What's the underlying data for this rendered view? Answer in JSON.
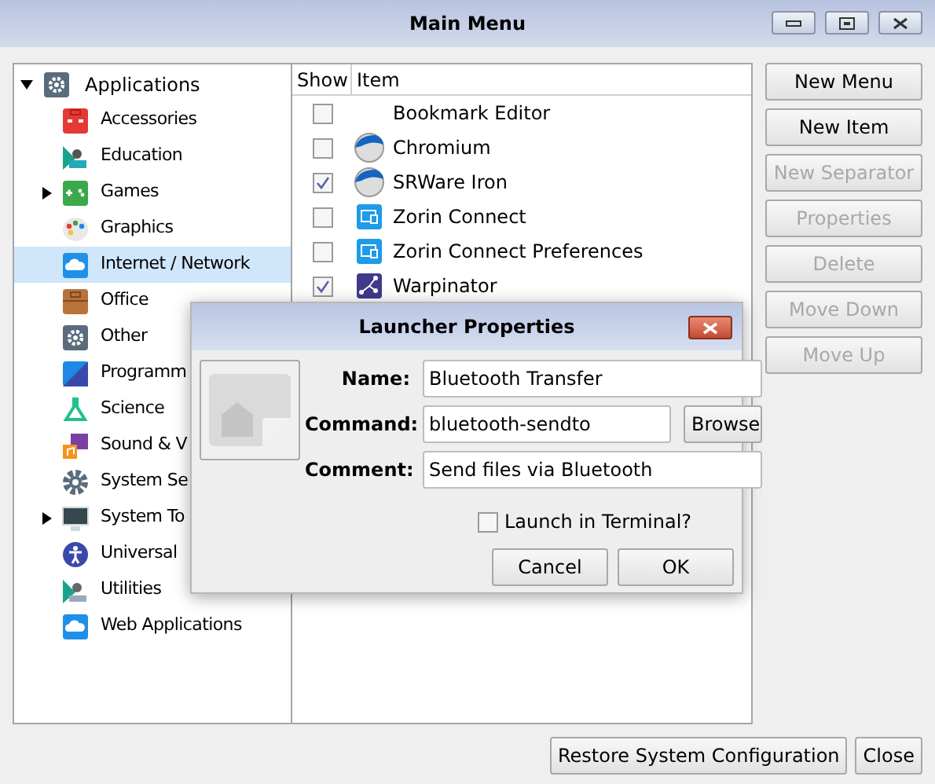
{
  "window": {
    "title": "Main Menu"
  },
  "tree": [
    {
      "label": "Applications",
      "selected": false,
      "expanded": true,
      "children": [
        {
          "label": "Accessories",
          "selected": false
        },
        {
          "label": "Education",
          "selected": false
        },
        {
          "label": "Games",
          "selected": false,
          "expanded": false
        },
        {
          "label": "Graphics",
          "selected": false
        },
        {
          "label": "Internet / Network",
          "selected": true
        },
        {
          "label": "Office",
          "selected": false
        },
        {
          "label": "Other",
          "selected": false
        },
        {
          "label": "Programm",
          "selected": false
        },
        {
          "label": "Science",
          "selected": false
        },
        {
          "label": "Sound & V",
          "selected": false
        },
        {
          "label": "System Se",
          "selected": false
        },
        {
          "label": "System To",
          "selected": false,
          "expanded": false
        },
        {
          "label": "Universal",
          "selected": false
        },
        {
          "label": "Utilities",
          "selected": false
        },
        {
          "label": "Web Applications",
          "selected": false
        }
      ]
    }
  ],
  "items_table": {
    "columns": [
      "Show",
      "Item"
    ],
    "rows": [
      {
        "item": "Bookmark Editor",
        "checked": false
      },
      {
        "item": "Chromium",
        "checked": false
      },
      {
        "item": "SRWare Iron",
        "checked": true
      },
      {
        "item": "Zorin Connect",
        "checked": false
      },
      {
        "item": "Zorin Connect Preferences",
        "checked": false
      },
      {
        "item": "Warpinator",
        "checked": true
      }
    ]
  },
  "side_buttons": [
    {
      "label": "New Menu",
      "disabled": false
    },
    {
      "label": "New Item",
      "disabled": false
    },
    {
      "label": "New Separator",
      "disabled": true
    },
    {
      "label": "Properties",
      "disabled": true
    },
    {
      "label": "Delete",
      "disabled": true
    },
    {
      "label": "Move Down",
      "disabled": true
    },
    {
      "label": "Move Up",
      "disabled": true
    }
  ],
  "bottom_buttons": [
    "Restore System Configuration",
    "Close"
  ],
  "dialog": {
    "title": "Launcher Properties",
    "fields": [
      {
        "label": "Name:",
        "value": "Bluetooth Transfer"
      },
      {
        "label": "Command:",
        "value": "bluetooth-sendto",
        "button": "Browse"
      },
      {
        "label": "Comment:",
        "value": "Send files via Bluetooth"
      }
    ],
    "terminal": {
      "label": "Launch in Terminal?",
      "checked": false
    },
    "buttons": [
      "Cancel",
      "OK"
    ]
  }
}
